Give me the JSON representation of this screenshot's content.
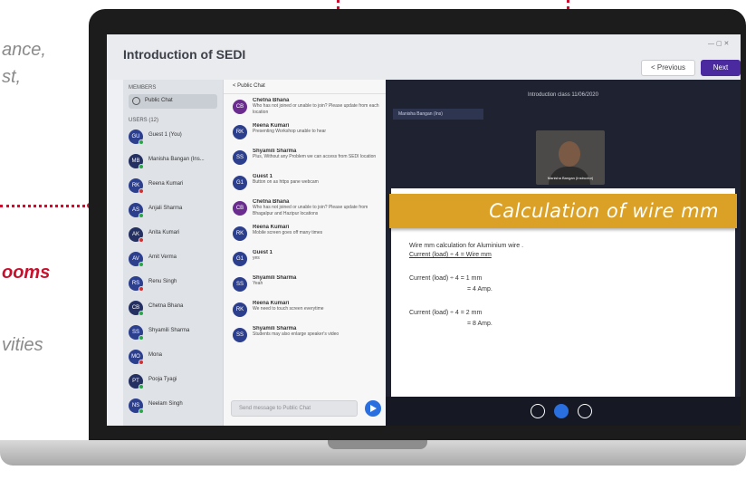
{
  "side": {
    "line1": "ance,",
    "line2": "st,",
    "line3": "ooms",
    "line4": "vities"
  },
  "lms": {
    "course_title": "Introduction of SEDI",
    "prev_label": "< Previous",
    "next_label": "Next"
  },
  "people": {
    "header": "Members",
    "search_label": "Public Chat",
    "section": "Users (12)",
    "items": [
      {
        "initials": "GU",
        "name": "Guest 1 (You)",
        "status": "green"
      },
      {
        "initials": "MB",
        "name": "Manisha Bangan (Ins...",
        "status": "green"
      },
      {
        "initials": "RK",
        "name": "Reena Kumari",
        "status": "red"
      },
      {
        "initials": "AS",
        "name": "Anjali Sharma",
        "status": "green"
      },
      {
        "initials": "AK",
        "name": "Anita Kumari",
        "status": "red"
      },
      {
        "initials": "AV",
        "name": "Amit Verma",
        "status": "green"
      },
      {
        "initials": "RS",
        "name": "Renu Singh",
        "status": "red"
      },
      {
        "initials": "CB",
        "name": "Chetna Bhana",
        "status": "green"
      },
      {
        "initials": "SS",
        "name": "Shyamili Sharma",
        "status": "green"
      },
      {
        "initials": "MO",
        "name": "Mona",
        "status": "red"
      },
      {
        "initials": "PT",
        "name": "Pooja Tyagi",
        "status": "green"
      },
      {
        "initials": "NS",
        "name": "Neelam Singh",
        "status": "green"
      }
    ]
  },
  "chat": {
    "header": "< Public Chat",
    "messages": [
      {
        "initials": "CB",
        "name": "Chetna Bhana",
        "text": "Who has not joined or unable to join? Please update from each location"
      },
      {
        "initials": "RK",
        "name": "Reena Kumari",
        "text": "Presenting Workshop unable to hear"
      },
      {
        "initials": "SS",
        "name": "Shyamili Sharma",
        "text": "Plus, Without any Problem we can access from SEDI location"
      },
      {
        "initials": "G1",
        "name": "Guest 1",
        "text": "Button on as https pane webcam"
      },
      {
        "initials": "CB",
        "name": "Chetna Bhana",
        "text": "Who has not joined or unable to join? Please update from Bhagalpur and Hazipur locations"
      },
      {
        "initials": "RK",
        "name": "Reena Kumari",
        "text": "Mobile screen goes off many times"
      },
      {
        "initials": "G1",
        "name": "Guest 1",
        "text": "yes"
      },
      {
        "initials": "SS",
        "name": "Shyamili Sharma",
        "text": "Yeah"
      },
      {
        "initials": "RK",
        "name": "Reena Kumari",
        "text": "We need to touch screen everytime"
      },
      {
        "initials": "SS",
        "name": "Shyamili Sharma",
        "text": "Students may also enlarge speaker's video"
      }
    ],
    "input_placeholder": "Send message to Public Chat"
  },
  "presentation": {
    "session_info": "Introduction class 11/06/2020",
    "presenter_tag": "Manisha Bangan (Ins)",
    "video_name": "Manisha Bangan (Instructor)",
    "slide_title": "Calculation of wire mm",
    "line1": "Wire mm calculation for Aluminium wire .",
    "line2": "Current (load) ÷ 4 = Wire mm",
    "line3": "Current (load) ÷ 4 = 1 mm",
    "line4": "= 4 Amp.",
    "line5": "Current (load) ÷ 4 = 2 mm",
    "line6": "= 8 Amp."
  },
  "colors": {
    "accent": "#c8102e",
    "banner": "#dba026",
    "next_button": "#4b2aa0"
  }
}
